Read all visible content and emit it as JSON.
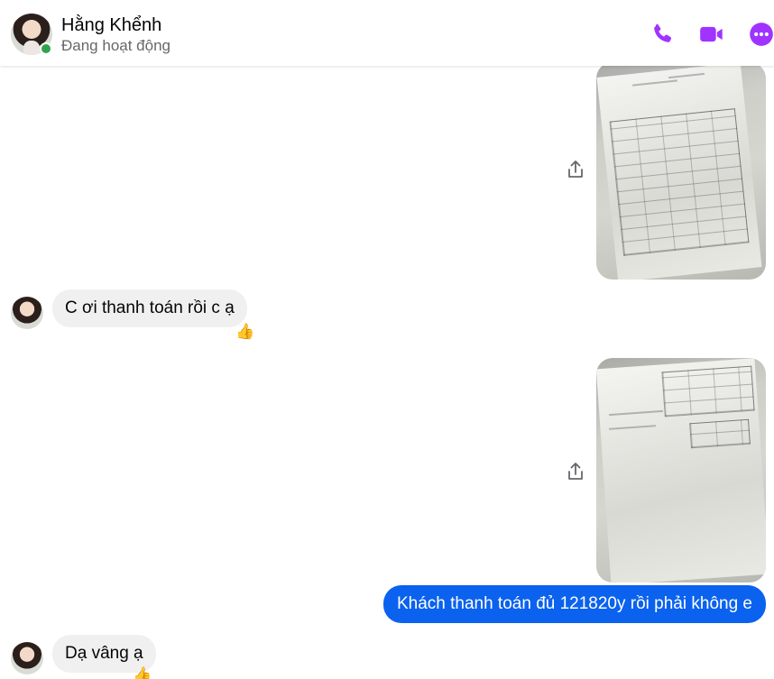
{
  "header": {
    "name": "Hằng Khểnh",
    "status": "Đang hoạt động"
  },
  "icons": {
    "accent": "#a033ff",
    "phone": "phone-icon",
    "video": "video-camera-icon",
    "more": "more-options-icon",
    "share": "share-icon"
  },
  "messages": [
    {
      "type": "image",
      "from": "me"
    },
    {
      "type": "text",
      "from": "them",
      "text": "C ơi thanh toán rồi c ạ",
      "reaction": "👍"
    },
    {
      "type": "image",
      "from": "me"
    },
    {
      "type": "text",
      "from": "me",
      "text": "Khách thanh toán đủ 121820y rồi phải không e"
    },
    {
      "type": "text",
      "from": "them",
      "text": "Dạ vâng ạ",
      "reaction": "👍"
    }
  ],
  "colors": {
    "outgoing_bubble": "#0a62ef",
    "incoming_bubble": "#f0f0f0",
    "online": "#31a24c"
  }
}
